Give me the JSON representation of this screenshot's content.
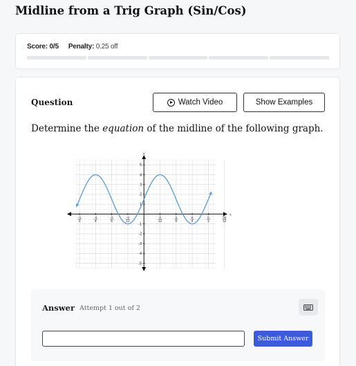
{
  "page": {
    "title": "Midline from a Trig Graph (Sin/Cos)"
  },
  "score": {
    "label": "Score: 0/5",
    "penalty_label": "Penalty:",
    "penalty_value": "0.25 off",
    "progress_segments": 5,
    "progress_filled": 0
  },
  "question": {
    "label": "Question",
    "watch_video_label": "Watch Video",
    "show_examples_label": "Show Examples",
    "prompt_before": "Determine the ",
    "prompt_emphasis": "equation",
    "prompt_after": " of the midline of the following graph."
  },
  "answer": {
    "label": "Answer",
    "attempt_text": "Attempt 1 out of 2",
    "input_value": "",
    "submit_label": "Submit Answer"
  },
  "icons": {
    "play": "play-circle-icon",
    "keyboard": "keyboard-icon"
  },
  "colors": {
    "accent": "#3b5bdb",
    "curve": "#5b9bd5"
  },
  "chart_data": {
    "type": "line",
    "xlabel": "x",
    "ylabel": "y",
    "xlim": [
      -1.25,
      1.38
    ],
    "ylim": [
      -5.8,
      6
    ],
    "x_ticks": [
      {
        "value": -1.0472,
        "num": "-π",
        "den": "3"
      },
      {
        "value": -0.7854,
        "num": "-π",
        "den": "4"
      },
      {
        "value": -0.5236,
        "num": "-π",
        "den": "6"
      },
      {
        "value": -0.2618,
        "num": "-π",
        "den": "12"
      },
      {
        "value": 0.2618,
        "num": "π",
        "den": "12"
      },
      {
        "value": 0.5236,
        "num": "π",
        "den": "6"
      },
      {
        "value": 0.7854,
        "num": "π",
        "den": "4"
      },
      {
        "value": 1.0472,
        "num": "π",
        "den": "3"
      },
      {
        "value": 1.309,
        "num": "5π",
        "den": "12"
      }
    ],
    "y_ticks": [
      -5,
      -4,
      -3,
      -2,
      -1,
      1,
      2,
      3,
      4,
      5
    ],
    "curve": {
      "amplitude": 2.5,
      "midline": 1.5,
      "period": 1.0472,
      "phase_peak": 0.2618,
      "x_range": [
        -1.1,
        1.1
      ]
    }
  }
}
